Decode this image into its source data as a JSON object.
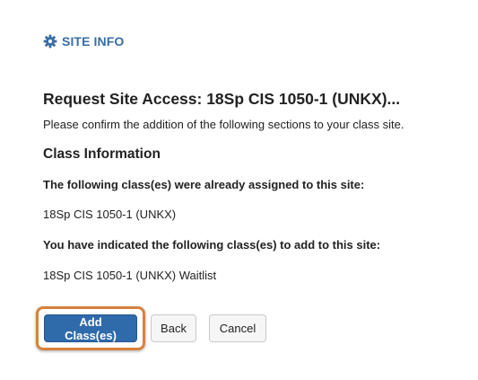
{
  "tool": {
    "icon": "gear-icon",
    "title": "SITE INFO",
    "color": "#3a6da6"
  },
  "page": {
    "heading": "Request Site Access: 18Sp CIS 1050-1 (UNKX)...",
    "instructions": "Please confirm the addition of the following sections to your class site."
  },
  "class_info": {
    "heading": "Class Information",
    "assigned_label": "The following class(es) were already assigned to this site:",
    "assigned_classes": [
      "18Sp CIS 1050-1 (UNKX)"
    ],
    "to_add_label": "You have indicated the following class(es) to add to this site:",
    "to_add_classes": [
      "18Sp CIS 1050-1 (UNKX) Waitlist"
    ]
  },
  "actions": {
    "add_label": "Add Class(es)",
    "back_label": "Back",
    "cancel_label": "Cancel",
    "primary_color": "#2f6aab",
    "highlight_color": "#d8813e"
  }
}
